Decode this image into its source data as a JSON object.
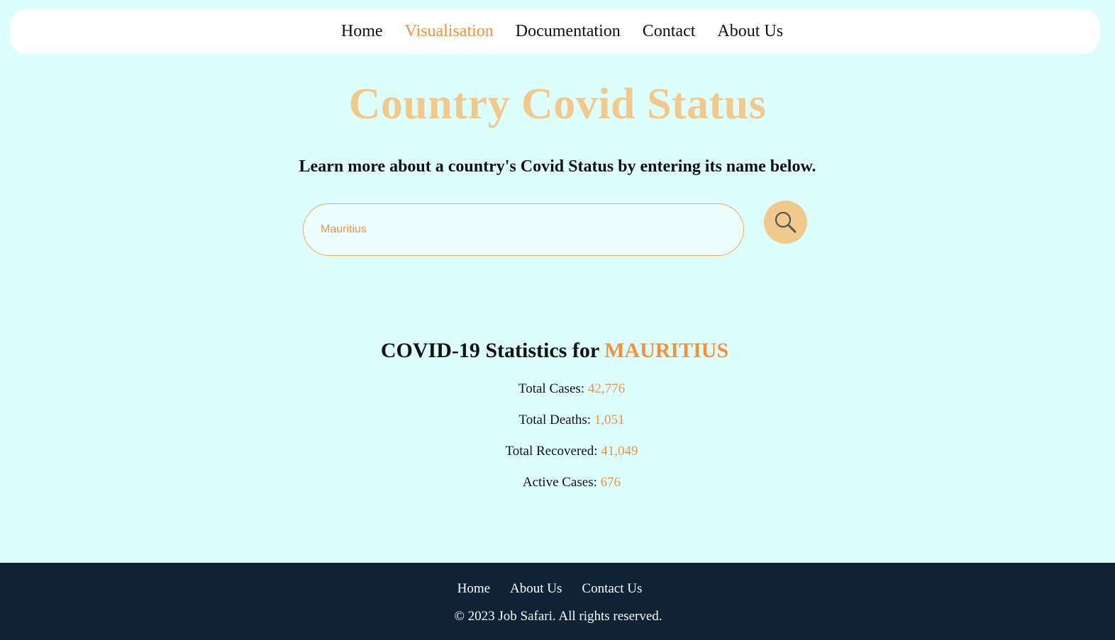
{
  "nav": {
    "items": [
      {
        "label": "Home",
        "active": false
      },
      {
        "label": "Visualisation",
        "active": true
      },
      {
        "label": "Documentation",
        "active": false
      },
      {
        "label": "Contact",
        "active": false
      },
      {
        "label": "About Us",
        "active": false
      }
    ]
  },
  "hero": {
    "title": "Country Covid Status",
    "subtitle": "Learn more about a country's Covid Status by entering its name below."
  },
  "search": {
    "value": "Mauritius",
    "button_icon": "search-icon"
  },
  "stats": {
    "heading_prefix": "COVID-19 Statistics for ",
    "country": "MAURITIUS",
    "rows": [
      {
        "label": "Total Cases: ",
        "value": "42,776"
      },
      {
        "label": "Total Deaths: ",
        "value": "1,051"
      },
      {
        "label": "Total Recovered: ",
        "value": "41,049"
      },
      {
        "label": "Active Cases: ",
        "value": "676"
      }
    ]
  },
  "footer": {
    "links": [
      "Home",
      "About Us",
      "Contact Us"
    ],
    "copyright": "© 2023 Job Safari. All rights reserved."
  },
  "colors": {
    "background": "#dcfefd",
    "accent": "#f5913d",
    "title": "#f1c98d",
    "footer": "#0f2236"
  }
}
